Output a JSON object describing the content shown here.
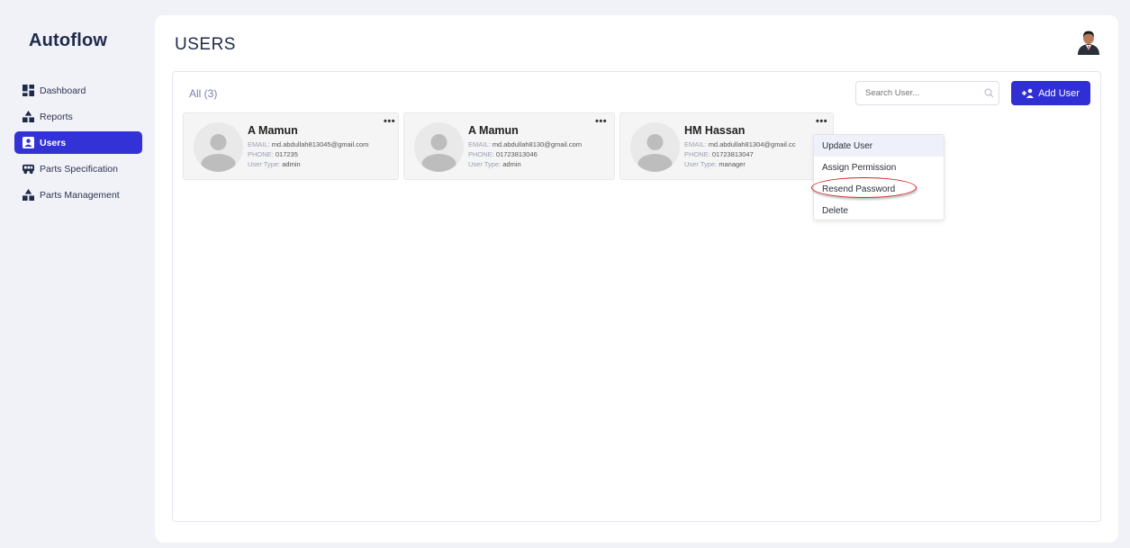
{
  "app": {
    "title": "Autoflow"
  },
  "sidebar": {
    "items": [
      {
        "label": "Dashboard",
        "icon": "dashboard-icon"
      },
      {
        "label": "Reports",
        "icon": "reports-icon"
      },
      {
        "label": "Users",
        "icon": "users-icon",
        "active": true
      },
      {
        "label": "Parts Specification",
        "icon": "bus-icon"
      },
      {
        "label": "Parts Management",
        "icon": "parts-icon"
      }
    ]
  },
  "header": {
    "title": "USERS"
  },
  "filter": {
    "all_label": "All (3)"
  },
  "search": {
    "placeholder": "Search User..."
  },
  "toolbar": {
    "add_label": "Add User"
  },
  "users": [
    {
      "name": "A Mamun",
      "email_label": "EMAIL:",
      "email": "md.abdullah813045@gmail.com",
      "phone_label": "PHONE:",
      "phone": "017235",
      "type_label": "User Type:",
      "type": "admin"
    },
    {
      "name": "A Mamun",
      "email_label": "EMAIL:",
      "email": "md.abdullah8130@gmail.com",
      "phone_label": "PHONE:",
      "phone": "01723813046",
      "type_label": "User Type:",
      "type": "admin"
    },
    {
      "name": "HM Hassan",
      "email_label": "EMAIL:",
      "email": "md.abdullah81304@gmail.cc",
      "phone_label": "PHONE:",
      "phone": "01723813047",
      "type_label": "User Type:",
      "type": "manager"
    }
  ],
  "more_label": "•••",
  "context_menu": {
    "items": [
      "Update User",
      "Assign Permission",
      "Resend Password",
      "Delete"
    ]
  },
  "colors": {
    "accent": "#2f2fd4",
    "highlight_ring": "#d52323"
  }
}
